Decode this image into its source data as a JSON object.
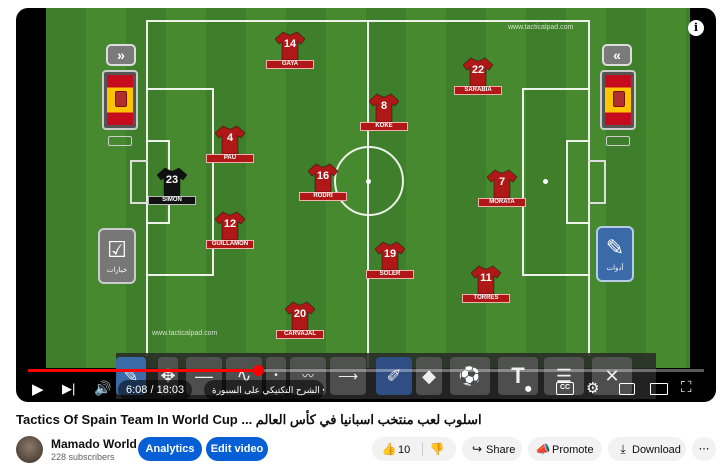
{
  "video": {
    "watermark_top": "www.tacticalpad.com",
    "watermark_bottom": "www.tacticalpad.com",
    "time": "6:08 / 18:03",
    "chapter": "الشرح التكتيكي على السبورة •",
    "info_icon": "i"
  },
  "players": [
    {
      "num": "14",
      "name": "GAYA",
      "kit": "red"
    },
    {
      "num": "22",
      "name": "SARABIA",
      "kit": "red"
    },
    {
      "num": "8",
      "name": "KOKE",
      "kit": "red"
    },
    {
      "num": "4",
      "name": "PAU",
      "kit": "red"
    },
    {
      "num": "16",
      "name": "RODRI",
      "kit": "red"
    },
    {
      "num": "7",
      "name": "MORATA",
      "kit": "red"
    },
    {
      "num": "23",
      "name": "SIMON",
      "kit": "black"
    },
    {
      "num": "12",
      "name": "GUILLAMON",
      "kit": "red"
    },
    {
      "num": "19",
      "name": "SOLER",
      "kit": "red"
    },
    {
      "num": "11",
      "name": "TORRES",
      "kit": "red"
    },
    {
      "num": "20",
      "name": "CARVAJAL",
      "kit": "red"
    }
  ],
  "side": {
    "left_chevron": "»",
    "right_chevron": "«",
    "left_tool_label": "خيارات",
    "right_tool_label": "أدوات"
  },
  "toolbar_label": "T",
  "video_title": "اسلوب لعب منتخب اسبانيا في كأس العالم ... Tactics Of Spain Team In World Cup",
  "channel": {
    "name": "Mamado World",
    "subscribers": "228 subscribers"
  },
  "buttons": {
    "analytics": "Analytics",
    "edit_video": "Edit video",
    "likes": "10",
    "share": "Share",
    "promote": "Promote",
    "download": "Download",
    "more": "⋯"
  },
  "colors": {
    "accent_red": "#ff0000",
    "brand_blue": "#065fd4",
    "shirt_red": "#b01818"
  },
  "progress_fraction": 0.34
}
